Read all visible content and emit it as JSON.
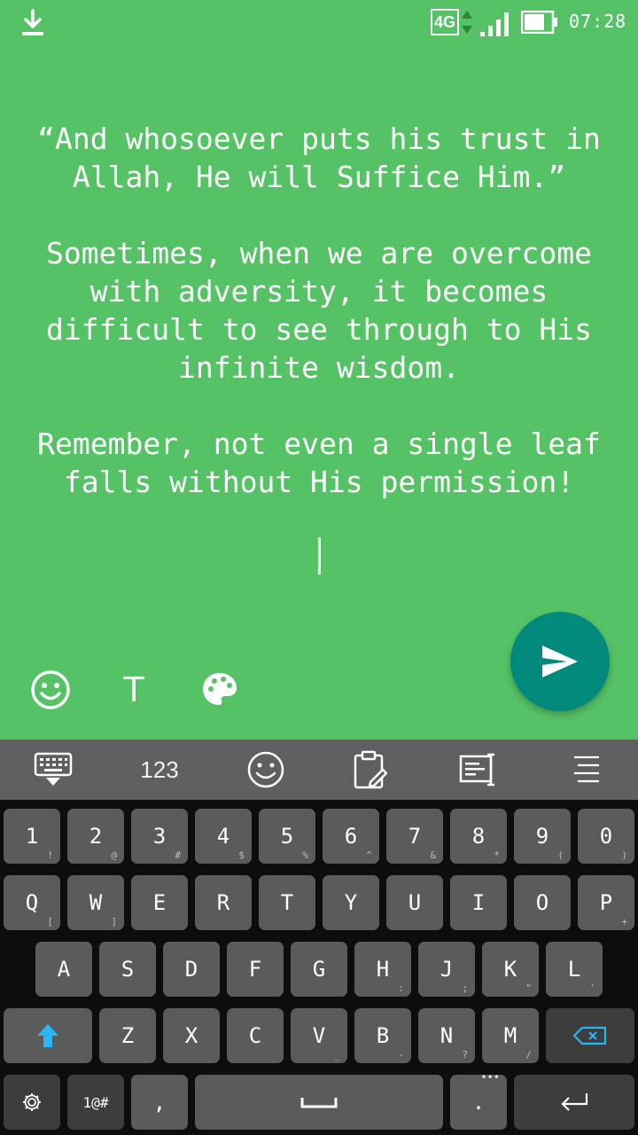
{
  "status_bar": {
    "network_type": "4G",
    "time": "07:28",
    "icons": [
      "download-icon",
      "network-arrows-icon",
      "signal-icon",
      "battery-icon"
    ]
  },
  "composer": {
    "paragraphs": [
      "“And whosoever puts his trust in Allah, He will Suffice Him.”",
      "Sometimes, when we are overcome with adversity, it becomes difficult to see through to His infinite wisdom.",
      "Remember, not even a single leaf falls without His permission!"
    ],
    "background_color": "#55c266"
  },
  "tools": {
    "emoji_icon": "emoji-icon",
    "text_label": "T",
    "palette_icon": "palette-icon",
    "send_icon": "send-icon",
    "send_color": "#01897b"
  },
  "keyboard_toolbar": {
    "numbers_label": "123",
    "icons": [
      "keyboard-hide-icon",
      "emoji-icon",
      "clipboard-icon",
      "text-edit-icon",
      "menu-icon"
    ]
  },
  "keyboard": {
    "row1": [
      {
        "main": "1",
        "sub": "!"
      },
      {
        "main": "2",
        "sub": "@"
      },
      {
        "main": "3",
        "sub": "#"
      },
      {
        "main": "4",
        "sub": "$"
      },
      {
        "main": "5",
        "sub": "%"
      },
      {
        "main": "6",
        "sub": "^"
      },
      {
        "main": "7",
        "sub": "&"
      },
      {
        "main": "8",
        "sub": "*"
      },
      {
        "main": "9",
        "sub": "("
      },
      {
        "main": "0",
        "sub": ")"
      }
    ],
    "row2": [
      {
        "main": "Q",
        "sub": "["
      },
      {
        "main": "W",
        "sub": "]"
      },
      {
        "main": "E",
        "sub": ""
      },
      {
        "main": "R",
        "sub": ""
      },
      {
        "main": "T",
        "sub": ""
      },
      {
        "main": "Y",
        "sub": ""
      },
      {
        "main": "U",
        "sub": ""
      },
      {
        "main": "I",
        "sub": ""
      },
      {
        "main": "O",
        "sub": ""
      },
      {
        "main": "P",
        "sub": "+"
      }
    ],
    "row3": [
      {
        "main": "A",
        "sub": ""
      },
      {
        "main": "S",
        "sub": ""
      },
      {
        "main": "D",
        "sub": ""
      },
      {
        "main": "F",
        "sub": ""
      },
      {
        "main": "G",
        "sub": ""
      },
      {
        "main": "H",
        "sub": ":"
      },
      {
        "main": "J",
        "sub": ";"
      },
      {
        "main": "K",
        "sub": "\""
      },
      {
        "main": "L",
        "sub": "'"
      }
    ],
    "row4": [
      {
        "main": "Z",
        "sub": ""
      },
      {
        "main": "X",
        "sub": ""
      },
      {
        "main": "C",
        "sub": ""
      },
      {
        "main": "V",
        "sub": "_"
      },
      {
        "main": "B",
        "sub": "-"
      },
      {
        "main": "N",
        "sub": "?"
      },
      {
        "main": "M",
        "sub": "/"
      }
    ],
    "symbols_label": "1@#",
    "comma_label": ",",
    "period_label": ".",
    "period_sub": "•••",
    "shift_color": "#29b6f6",
    "backspace_color": "#29b6f6"
  }
}
